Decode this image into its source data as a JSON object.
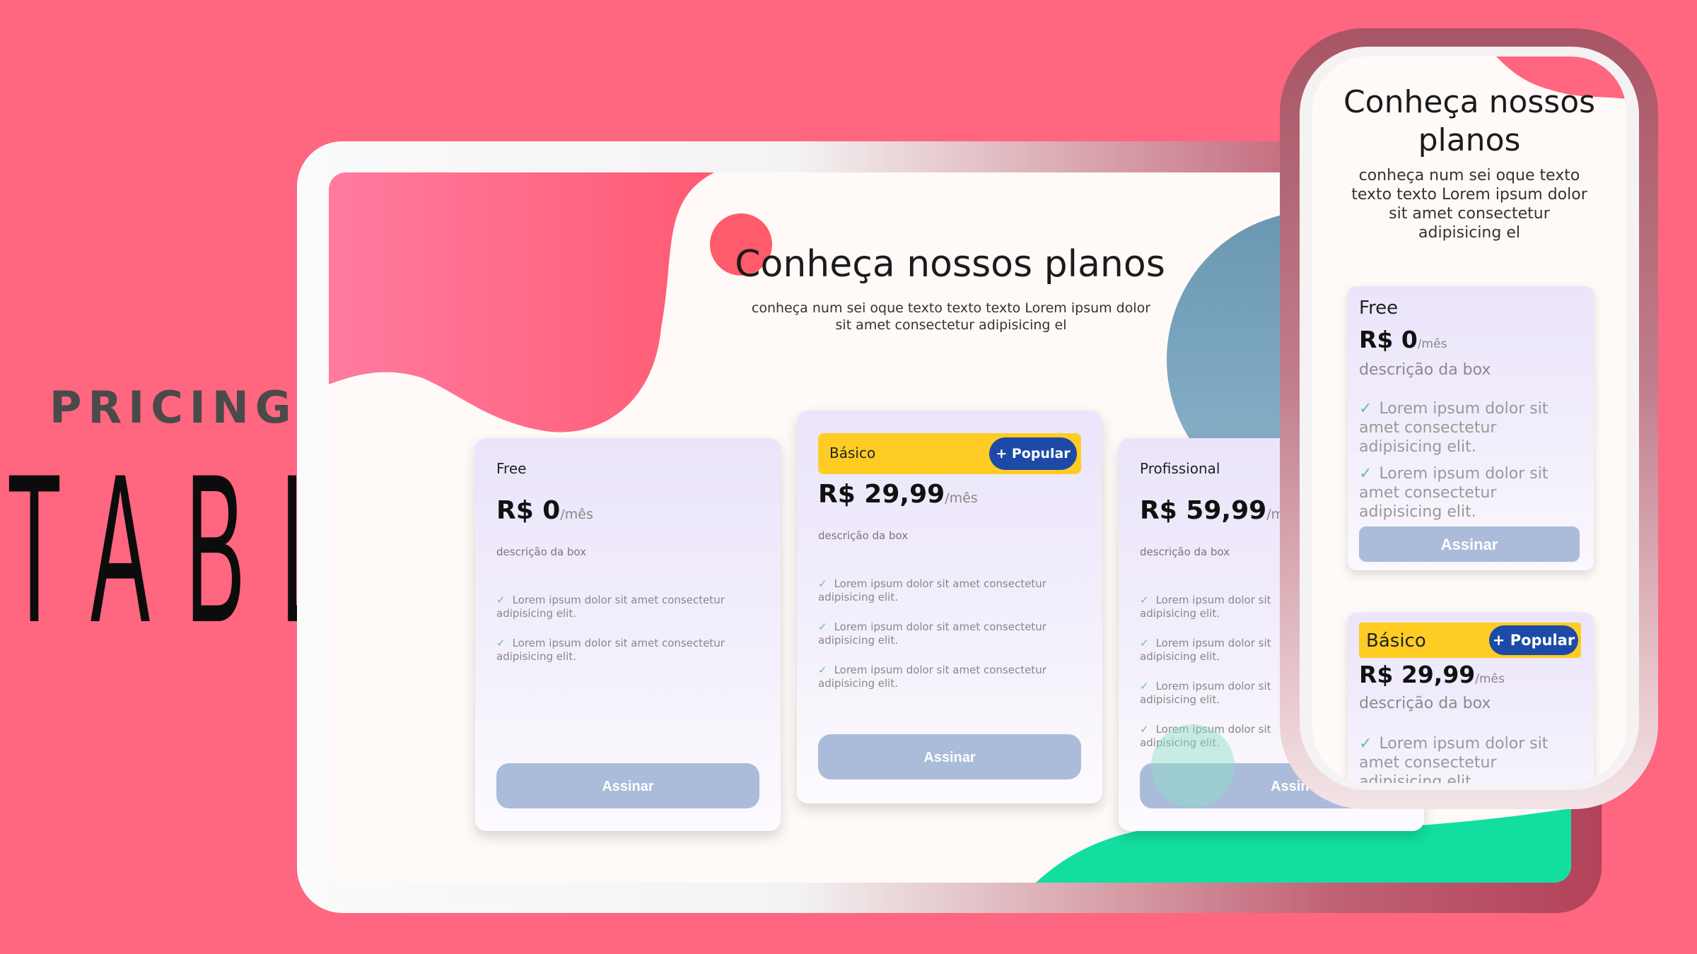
{
  "side_heading": {
    "top": "PRICING",
    "bottom": "TABLE"
  },
  "colors": {
    "background": "#ff6680",
    "accent_yellow": "#ffcc24",
    "popular_blue": "#1c4aa6",
    "button": "#aabcda",
    "check": "#6bbf8c",
    "blob_pink": "#ff6680",
    "blob_blue": "#6f9fb5",
    "blob_green": "#12dea0"
  },
  "desktop": {
    "title": "Conheça nossos planos",
    "subtitle": "conheça num sei oque texto texto texto Lorem ipsum dolor sit amet consectetur adipisicing el",
    "plans": [
      {
        "name": "Free",
        "price": "R$ 0",
        "unit": "/mês",
        "description": "descrição da box",
        "features": [
          "Lorem ipsum dolor sit amet consectetur adipisicing elit.",
          "Lorem ipsum dolor sit amet consectetur adipisicing elit."
        ],
        "button": "Assinar"
      },
      {
        "name": "Básico",
        "badge": "+ Popular",
        "price": "R$ 29,99",
        "unit": "/mês",
        "description": "descrição da box",
        "features": [
          "Lorem ipsum dolor sit amet consectetur adipisicing elit.",
          "Lorem ipsum dolor sit amet consectetur adipisicing elit.",
          "Lorem ipsum dolor sit amet consectetur adipisicing elit."
        ],
        "button": "Assinar"
      },
      {
        "name": "Profissional",
        "price": "R$ 59,99",
        "unit": "/m",
        "description": "descrição da box",
        "features": [
          "Lorem ipsum dolor sit",
          "Lorem ipsum dolor sit",
          "Lorem ipsum dolor sit",
          "Lorem ipsum dolor sit"
        ],
        "features_wrap": "adipisicing elit.",
        "button": "Assin"
      }
    ]
  },
  "mobile": {
    "title": "Conheça nossos planos",
    "subtitle": "conheça num sei oque texto texto texto Lorem ipsum dolor sit amet consectetur adipisicing el",
    "plans": [
      {
        "name": "Free",
        "price": "R$ 0",
        "unit": "/mês",
        "description": "descrição da box",
        "features": [
          "Lorem ipsum dolor sit amet consectetur adipisicing elit.",
          "Lorem ipsum dolor sit amet consectetur adipisicing elit."
        ],
        "button": "Assinar"
      },
      {
        "name": "Básico",
        "badge": "+ Popular",
        "price": "R$ 29,99",
        "unit": "/mês",
        "description": "descrição da box",
        "features": [
          "Lorem ipsum dolor sit amet consectetur adipisicing elit"
        ]
      }
    ]
  }
}
